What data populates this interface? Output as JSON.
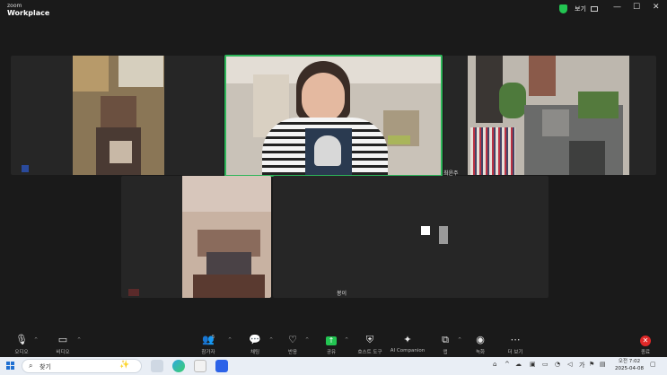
{
  "titlebar": {
    "logo_top": "zoom",
    "logo_bottom": "Workplace",
    "view_label": "보기",
    "minimize": "—",
    "maximize": "☐",
    "close": "✕"
  },
  "participants": [
    {
      "name": ""
    },
    {
      "name": "",
      "active": true
    },
    {
      "name": "최윤주"
    },
    {
      "name": ""
    },
    {
      "name": "봉이"
    }
  ],
  "toolbar": {
    "audio": "오디오",
    "video": "비디오",
    "participants": "참가자",
    "participants_count": "5",
    "chat": "채팅",
    "react": "반응",
    "share": "공유",
    "host_tools": "호스트 도구",
    "ai_companion": "AI Companion",
    "apps": "앱",
    "record": "녹화",
    "more": "더 보기",
    "end": "종료"
  },
  "taskbar": {
    "search_placeholder": "찾기",
    "time": "오전 7:02",
    "date": "2025-04-08"
  },
  "colors": {
    "active_speaker": "#2db559",
    "share_green": "#23c552",
    "end_red": "#e02828"
  }
}
